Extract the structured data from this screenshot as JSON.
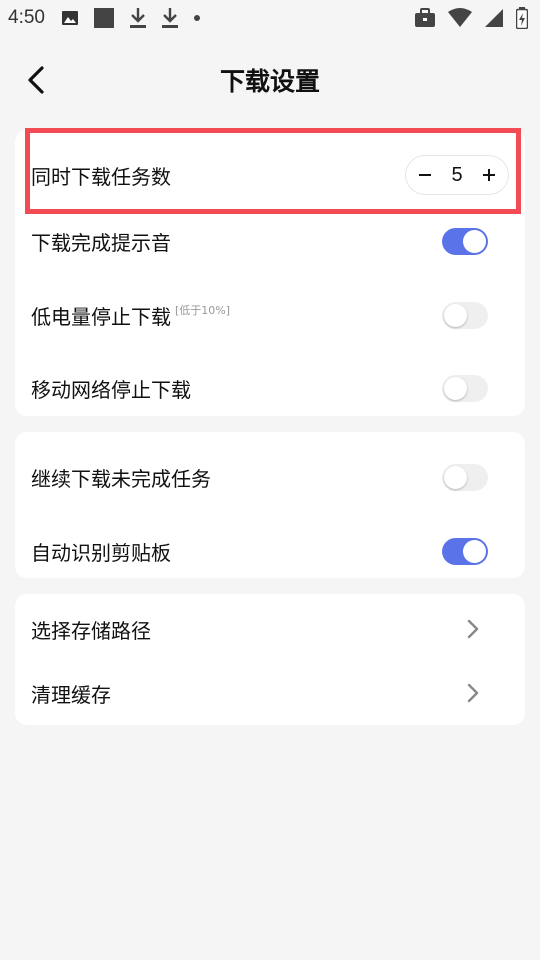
{
  "status_bar": {
    "time": "4:50",
    "left_icons": [
      "image-icon",
      "square-icon",
      "download-icon",
      "download-icon",
      "dot-icon"
    ],
    "right_icons": [
      "briefcase-icon",
      "wifi-icon",
      "signal-icon",
      "battery-icon"
    ]
  },
  "header": {
    "title": "下载设置",
    "back_icon": "chevron-left-icon"
  },
  "sections": [
    {
      "items": [
        {
          "label": "同时下载任务数",
          "control": "stepper",
          "value": "5",
          "minus": "−",
          "plus": "+"
        },
        {
          "label": "下载完成提示音",
          "control": "toggle",
          "on": true
        },
        {
          "label": "低电量停止下载",
          "note": "[低于10%]",
          "control": "toggle",
          "on": false
        },
        {
          "label": "移动网络停止下载",
          "control": "toggle",
          "on": false
        }
      ]
    },
    {
      "items": [
        {
          "label": "继续下载未完成任务",
          "control": "toggle",
          "on": false
        },
        {
          "label": "自动识别剪贴板",
          "control": "toggle",
          "on": true
        }
      ]
    },
    {
      "items": [
        {
          "label": "选择存储路径",
          "control": "chevron"
        },
        {
          "label": "清理缓存",
          "control": "chevron"
        }
      ]
    }
  ],
  "colors": {
    "accent": "#5b73e8",
    "highlight": "#f24b55",
    "background": "#f5f5f5"
  }
}
